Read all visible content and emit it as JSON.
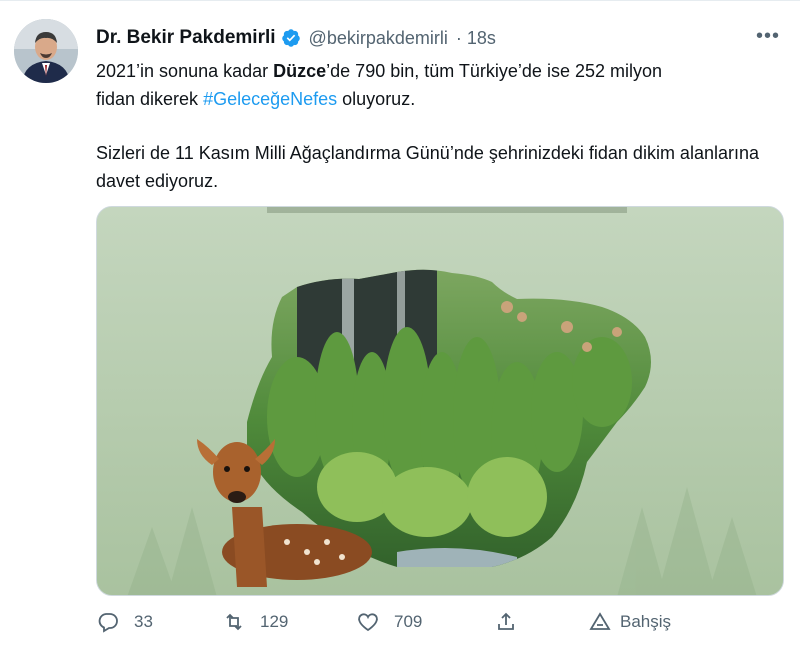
{
  "author": {
    "name": "Dr. Bekir Pakdemirli",
    "handle": "@bekirpakdemirli",
    "time": "· 18s"
  },
  "tweet": {
    "line1_a": "2021’in sonuna kadar ",
    "line1_bold": "Düzce",
    "line1_b": "’de 790 bin, tüm Türkiye’de ise 252 milyon",
    "line2_a": "fidan dikerek ",
    "hashtag": "#GeleceğeNefes",
    "line2_b": " oluyoruz.",
    "paragraph2": "Sizleri de 11 Kasım Milli Ağaçlandırma Günü’nde şehrinizdeki fidan dikim alanlarına davet ediyoruz."
  },
  "actions": {
    "reply_count": "33",
    "retweet_count": "129",
    "like_count": "709",
    "tip_label": "Bahşiş"
  },
  "icons": {
    "verified": "verified-badge-icon",
    "more": "more-icon",
    "reply": "reply-icon",
    "retweet": "retweet-icon",
    "like": "heart-icon",
    "share": "share-icon",
    "tip": "tip-icon"
  },
  "colors": {
    "accent": "#1d9bf0",
    "secondary_text": "#536471",
    "media_bg": "#b9cdb1"
  }
}
